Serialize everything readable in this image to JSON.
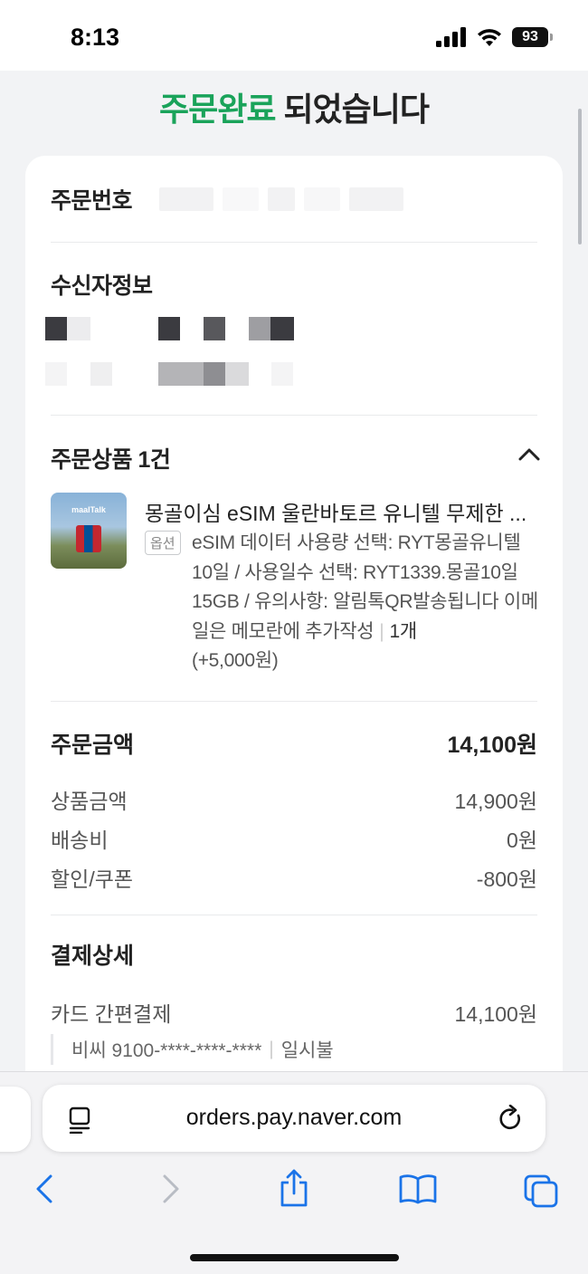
{
  "status_bar": {
    "time": "8:13",
    "battery": "93"
  },
  "header": {
    "title_accent": "주문완료",
    "title_rest": " 되었습니다"
  },
  "order": {
    "number_label": "주문번호"
  },
  "recipient": {
    "label": "수신자정보"
  },
  "products": {
    "label": "주문상품 1건",
    "thumb_brand": "maalTalk",
    "item": {
      "name": "몽골이심 eSIM 울란바토르 유니텔 무제한 ...",
      "option_badge": "옵션",
      "option_text": "eSIM 데이터 사용량 선택: RYT몽골유니텔 10일 / 사용일수 선택: RYT1339.몽골10일15GB / 유의사항: 알림톡QR발송됩니다 이메일은 메모란에 추가작성",
      "quantity": "1개",
      "extra_price": "(+5,000원)"
    }
  },
  "amounts": {
    "order_total_label": "주문금액",
    "order_total": "14,100원",
    "lines": [
      {
        "label": "상품금액",
        "value": "14,900원"
      },
      {
        "label": "배송비",
        "value": "0원"
      },
      {
        "label": "할인/쿠폰",
        "value": "-800원"
      }
    ]
  },
  "payment": {
    "label": "결제상세",
    "method_label": "카드 간편결제",
    "method_value": "14,100원",
    "card": "비씨 9100-****-****-****",
    "installment": "일시불"
  },
  "browser": {
    "url": "orders.pay.naver.com"
  },
  "colors": {
    "accent": "#1aa35a",
    "ios_blue": "#1a73e8"
  }
}
